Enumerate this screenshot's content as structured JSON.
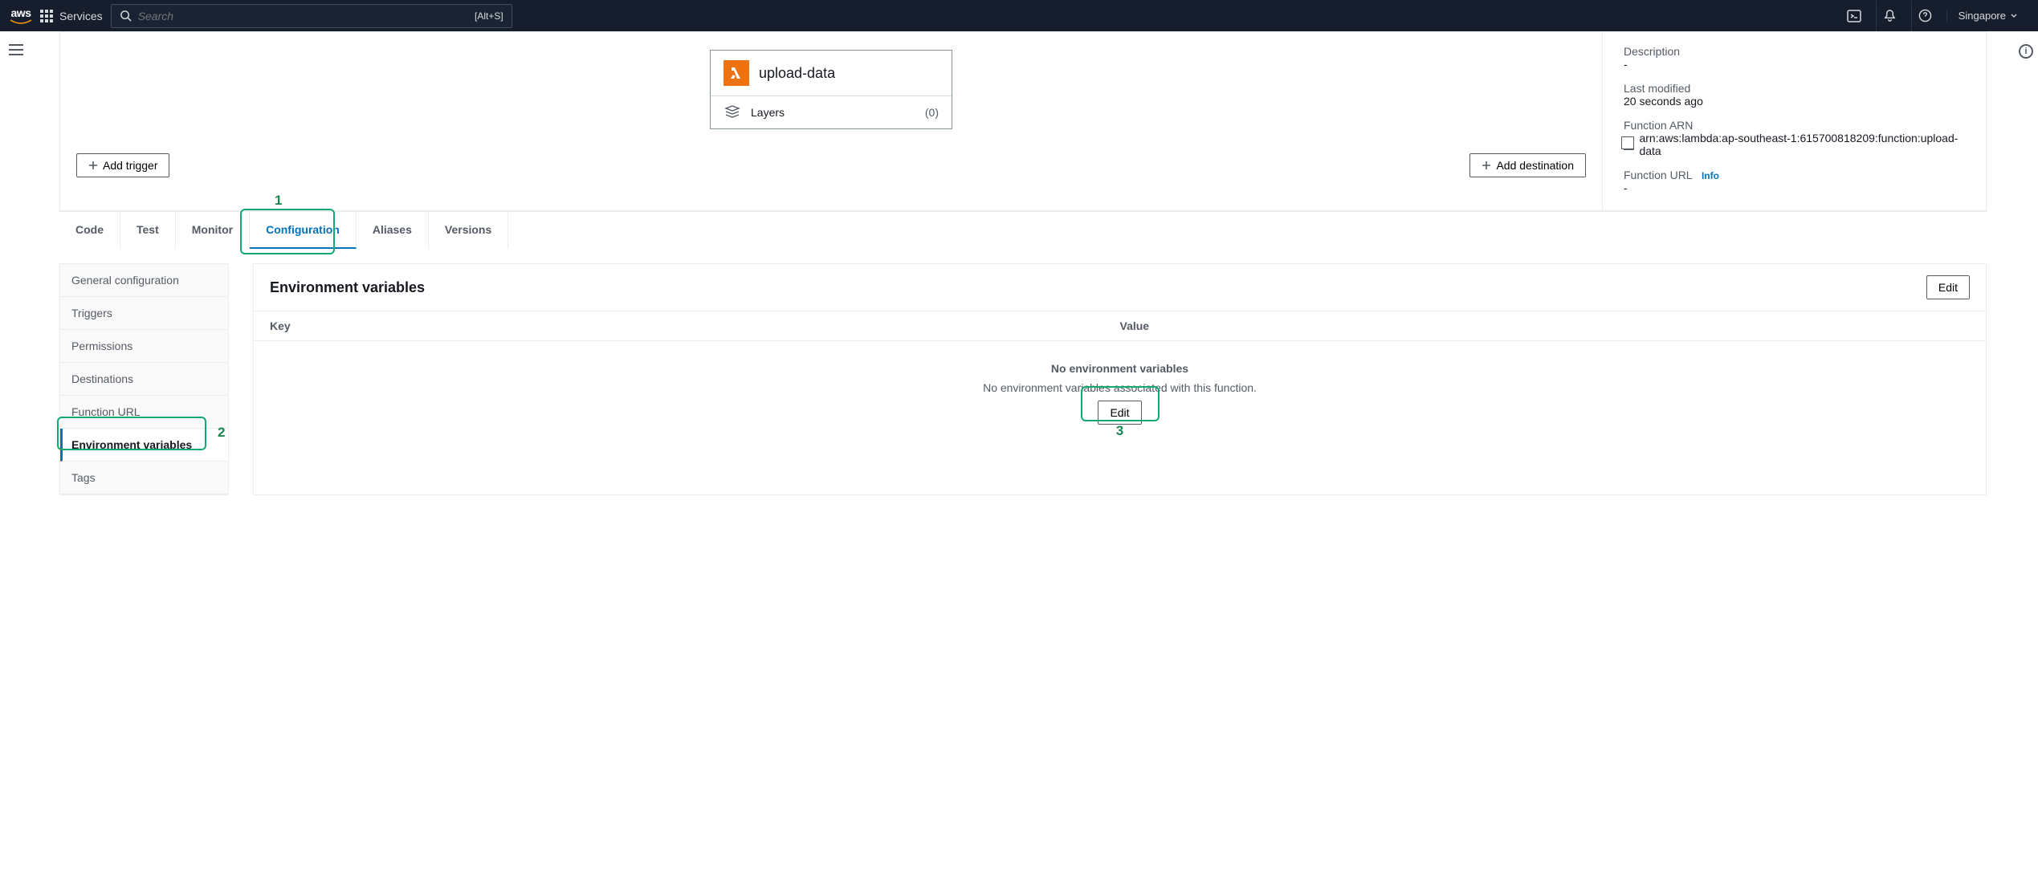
{
  "header": {
    "services": "Services",
    "search_placeholder": "Search",
    "shortcut": "[Alt+S]",
    "region": "Singapore"
  },
  "function": {
    "name": "upload-data",
    "layers_label": "Layers",
    "layers_count": "(0)",
    "add_trigger": "Add trigger",
    "add_destination": "Add destination"
  },
  "meta": {
    "description_label": "Description",
    "description_value": "-",
    "last_modified_label": "Last modified",
    "last_modified_value": "20 seconds ago",
    "arn_label": "Function ARN",
    "arn_value": "arn:aws:lambda:ap-southeast-1:615700818209:function:upload-data",
    "url_label": "Function URL",
    "url_info": "Info",
    "url_value": "-"
  },
  "tabs": {
    "code": "Code",
    "test": "Test",
    "monitor": "Monitor",
    "configuration": "Configuration",
    "aliases": "Aliases",
    "versions": "Versions"
  },
  "side_nav": [
    "General configuration",
    "Triggers",
    "Permissions",
    "Destinations",
    "Function URL",
    "Environment variables",
    "Tags"
  ],
  "env_panel": {
    "title": "Environment variables",
    "edit": "Edit",
    "col_key": "Key",
    "col_value": "Value",
    "empty_title": "No environment variables",
    "empty_msg": "No environment variables associated with this function.",
    "empty_edit": "Edit"
  },
  "annotations": {
    "a1": "1",
    "a2": "2",
    "a3": "3"
  }
}
